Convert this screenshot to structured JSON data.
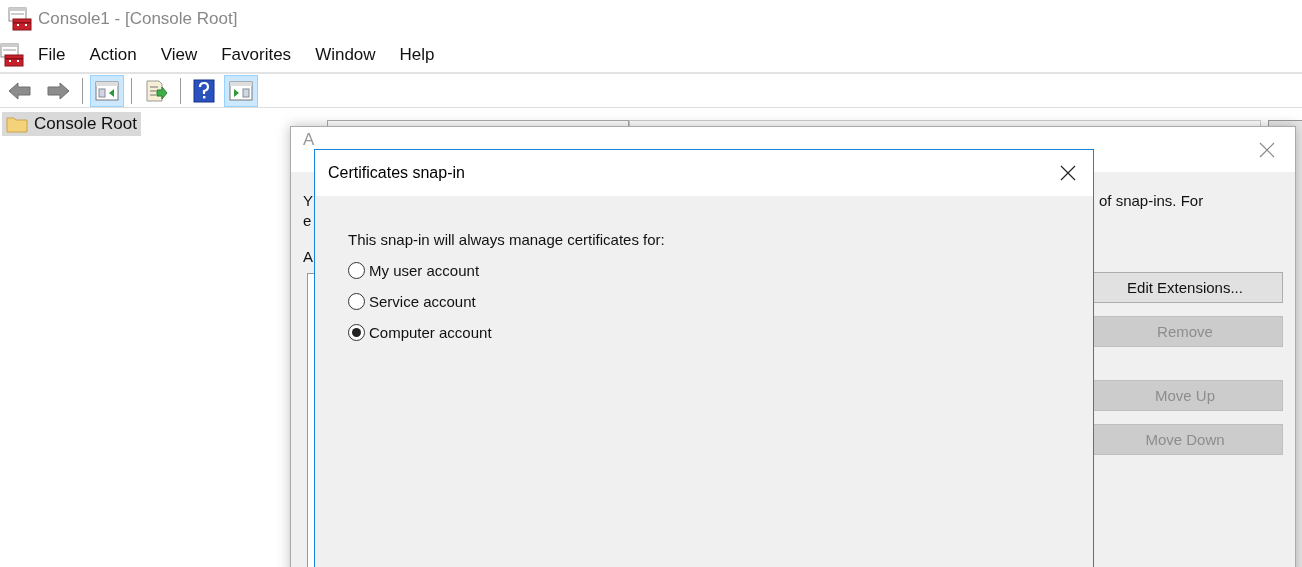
{
  "window": {
    "title": "Console1 - [Console Root]"
  },
  "menu": [
    "File",
    "Action",
    "View",
    "Favorites",
    "Window",
    "Help"
  ],
  "toolbar": [
    {
      "kind": "back"
    },
    {
      "kind": "forward"
    },
    {
      "kind": "separator"
    },
    {
      "kind": "tree-pane",
      "on": true
    },
    {
      "kind": "separator"
    },
    {
      "kind": "export"
    },
    {
      "kind": "separator"
    },
    {
      "kind": "help"
    },
    {
      "kind": "action-pane",
      "on": true
    }
  ],
  "tree": [
    {
      "label": "Console Root",
      "selected": true
    }
  ],
  "back_dialog": {
    "title": "A",
    "fragments": [
      "Y",
      "e",
      "A"
    ],
    "description": "of snap-ins. For",
    "buttons": [
      {
        "label": "Edit Extensions...",
        "disabled": false
      },
      {
        "label": "Remove",
        "disabled": true
      },
      {
        "label": "Move Up",
        "disabled": true
      },
      {
        "label": "Move Down",
        "disabled": true
      }
    ]
  },
  "dialog": {
    "title": "Certificates snap-in",
    "prompt": "This snap-in will always manage certificates for:",
    "options": [
      {
        "label": "My user account",
        "selected": false
      },
      {
        "label": "Service account",
        "selected": false
      },
      {
        "label": "Computer account",
        "selected": true
      }
    ]
  }
}
